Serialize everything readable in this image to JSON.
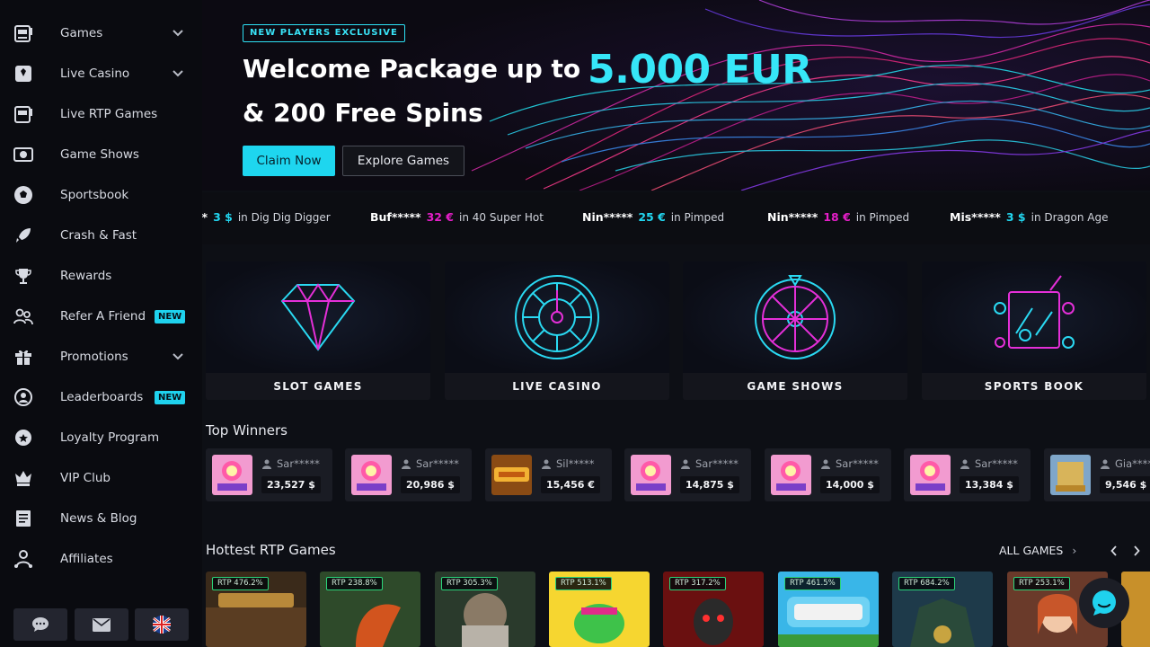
{
  "sidebar": {
    "items": [
      {
        "label": "Games",
        "icon": "slot-machine-icon",
        "chevron": true
      },
      {
        "label": "Live Casino",
        "icon": "playing-card-icon",
        "chevron": true
      },
      {
        "label": "Live RTP Games",
        "icon": "slot-machine-icon",
        "chevron": false
      },
      {
        "label": "Game Shows",
        "icon": "tv-show-icon",
        "chevron": false
      },
      {
        "label": "Sportsbook",
        "icon": "soccer-ball-icon",
        "chevron": false
      },
      {
        "label": "Crash & Fast",
        "icon": "rocket-icon",
        "chevron": false
      },
      {
        "label": "Rewards",
        "icon": "trophy-icon",
        "chevron": false
      },
      {
        "label": "Refer A Friend",
        "icon": "users-icon",
        "chevron": false,
        "badge": "NEW"
      },
      {
        "label": "Promotions",
        "icon": "gift-icon",
        "chevron": true
      },
      {
        "label": "Leaderboards",
        "icon": "leaderboard-icon",
        "chevron": false,
        "badge": "NEW"
      },
      {
        "label": "Loyalty Program",
        "icon": "loyalty-icon",
        "chevron": false
      },
      {
        "label": "VIP Club",
        "icon": "vip-crown-icon",
        "chevron": false
      },
      {
        "label": "News & Blog",
        "icon": "news-icon",
        "chevron": false
      },
      {
        "label": "Affiliates",
        "icon": "affiliates-icon",
        "chevron": false
      }
    ],
    "bottom_buttons": [
      "chat-icon",
      "mail-icon",
      "uk-flag-icon"
    ]
  },
  "banner": {
    "tag": "NEW PLAYERS EXCLUSIVE",
    "line1": "Welcome Package up to",
    "amount": "5.000 EUR",
    "line2": "& 200 Free Spins",
    "claim_label": "Claim Now",
    "explore_label": "Explore Games"
  },
  "ticker": [
    {
      "name": "**",
      "amount": "3 $",
      "game": "in Dig Dig Digger",
      "color": "#22d6f0"
    },
    {
      "name": "Buf*****",
      "amount": "32 €",
      "game": "in 40 Super Hot",
      "color": "#e51ec8"
    },
    {
      "name": "Nin*****",
      "amount": "25 €",
      "game": "in Pimped",
      "color": "#22d6f0"
    },
    {
      "name": "Nin*****",
      "amount": "18 €",
      "game": "in Pimped",
      "color": "#e51ec8"
    },
    {
      "name": "Mis*****",
      "amount": "3 $",
      "game": "in Dragon Age",
      "color": "#22d6f0"
    }
  ],
  "categories": [
    "SLOT GAMES",
    "LIVE CASINO",
    "GAME SHOWS",
    "SPORTS BOOK"
  ],
  "top_winners": {
    "title": "Top Winners",
    "items": [
      {
        "user": "Sar*****",
        "amount": "23,527 $"
      },
      {
        "user": "Sar*****",
        "amount": "20,986 $"
      },
      {
        "user": "Sil*****",
        "amount": "15,456 €"
      },
      {
        "user": "Sar*****",
        "amount": "14,875 $"
      },
      {
        "user": "Sar*****",
        "amount": "14,000 $"
      },
      {
        "user": "Sar*****",
        "amount": "13,384 $"
      },
      {
        "user": "Gia*****",
        "amount": "9,546 $"
      }
    ]
  },
  "hottest": {
    "title": "Hottest RTP Games",
    "all_label": "ALL GAMES",
    "games": [
      {
        "rtp": "RTP 476.2%"
      },
      {
        "rtp": "RTP 238.8%"
      },
      {
        "rtp": "RTP 305.3%"
      },
      {
        "rtp": "RTP 513.1%"
      },
      {
        "rtp": "RTP 317.2%"
      },
      {
        "rtp": "RTP 461.5%"
      },
      {
        "rtp": "RTP 684.2%"
      },
      {
        "rtp": "RTP 253.1%"
      }
    ]
  }
}
